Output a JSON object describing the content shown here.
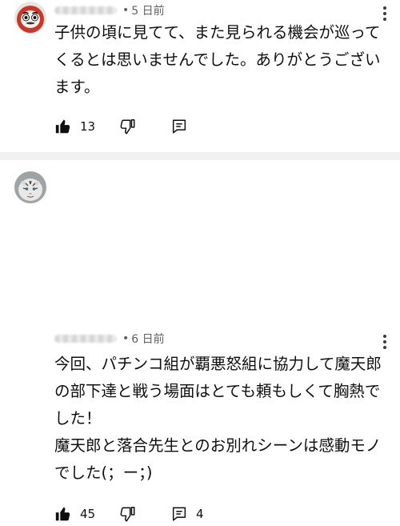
{
  "comments": [
    {
      "time": "5 日前",
      "text": "子供の頃に見てて、また見られる機会が巡って\nくるとは思いませんでした。ありがとうござい\nます。",
      "likes": "13",
      "replies": "",
      "avatar_icon": "daruma-avatar-icon"
    },
    {
      "time": "6 日前",
      "text": "今回、パチンコ組が覇悪怒組に協力して魔天郎\nの部下達と戦う場面はとても頼もしくて胸熱で\nした！\n魔天郎と落合先生とのお別れシーンは感動モノ\nでした(；ー；)",
      "likes": "45",
      "replies": "4",
      "avatar_icon": "white-tiger-avatar-icon"
    }
  ],
  "separator": "•",
  "colors": {
    "text": "#0f0f0f",
    "meta": "#606060",
    "divider": "#f0f0f0"
  },
  "icons": [
    "thumbs-up-icon",
    "thumbs-down-icon",
    "reply-icon",
    "more-vert-icon"
  ]
}
